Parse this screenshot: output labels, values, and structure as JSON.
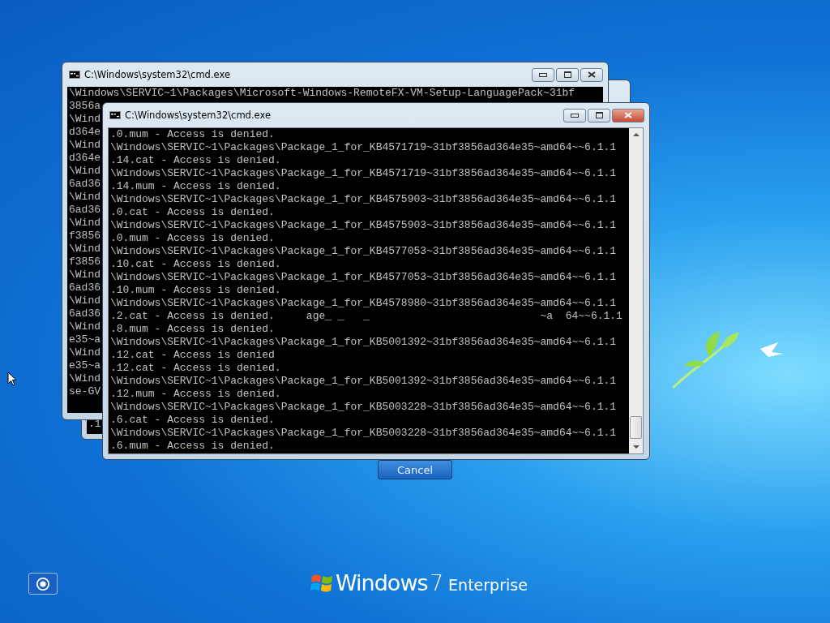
{
  "back_window": {
    "title": "C:\\Windows\\system32\\cmd.exe",
    "lines": [
      "\\Windows\\SERVIC~1\\Packages\\Microsoft-Windows-RemoteFX-VM-Setup-LanguagePack~31bf",
      "3856a",
      "\\Wind",
      "d364e",
      "\\Wind",
      "d364e",
      "\\Wind",
      "6ad36",
      "\\Wind",
      "6ad36",
      "\\Wind",
      "f3856",
      "\\Wind",
      "f3856",
      "\\Wind",
      "6ad36",
      "\\Wind",
      "6ad36",
      "\\Wind",
      "e35~a",
      "\\Wind",
      "e35~a",
      "\\Wind",
      "se-GV"
    ]
  },
  "middle_window": {
    "lines": [
      ".1"
    ]
  },
  "front_window": {
    "title": "C:\\Windows\\system32\\cmd.exe",
    "lines": [
      ".0.mum - Access is denied.",
      "\\Windows\\SERVIC~1\\Packages\\Package_1_for_KB4571719~31bf3856ad364e35~amd64~~6.1.1",
      ".14.cat - Access is denied.",
      "\\Windows\\SERVIC~1\\Packages\\Package_1_for_KB4571719~31bf3856ad364e35~amd64~~6.1.1",
      ".14.mum - Access is denied.",
      "\\Windows\\SERVIC~1\\Packages\\Package_1_for_KB4575903~31bf3856ad364e35~amd64~~6.1.1",
      ".0.cat - Access is denied.",
      "\\Windows\\SERVIC~1\\Packages\\Package_1_for_KB4575903~31bf3856ad364e35~amd64~~6.1.1",
      ".0.mum - Access is denied.",
      "\\Windows\\SERVIC~1\\Packages\\Package_1_for_KB4577053~31bf3856ad364e35~amd64~~6.1.1",
      ".10.cat - Access is denied.",
      "\\Windows\\SERVIC~1\\Packages\\Package_1_for_KB4577053~31bf3856ad364e35~amd64~~6.1.1",
      ".10.mum - Access is denied.",
      "\\Windows\\SERVIC~1\\Packages\\Package_1_for_KB4578980~31bf3856ad364e35~amd64~~6.1.1",
      ".2.cat - Access is denied.     age_ _   _                           ~a  64~~6.1.1",
      ".8.mum - Access is denied.",
      "\\Windows\\SERVIC~1\\Packages\\Package_1_for_KB5001392~31bf3856ad364e35~amd64~~6.1.1",
      ".12.cat - Access is denied",
      ".12.cat - Access is denied.",
      "\\Windows\\SERVIC~1\\Packages\\Package_1_for_KB5001392~31bf3856ad364e35~amd64~~6.1.1",
      ".12.mum - Access is denied.",
      "\\Windows\\SERVIC~1\\Packages\\Package_1_for_KB5003228~31bf3856ad364e35~amd64~~6.1.1",
      ".6.cat - Access is denied.",
      "\\Windows\\SERVIC~1\\Packages\\Package_1_for_KB5003228~31bf3856ad364e35~amd64~~6.1.1",
      ".6.mum - Access is denied."
    ]
  },
  "cancel_button": "Cancel",
  "branding": {
    "product": "Windows",
    "version": "7",
    "edition": "Enterprise"
  }
}
